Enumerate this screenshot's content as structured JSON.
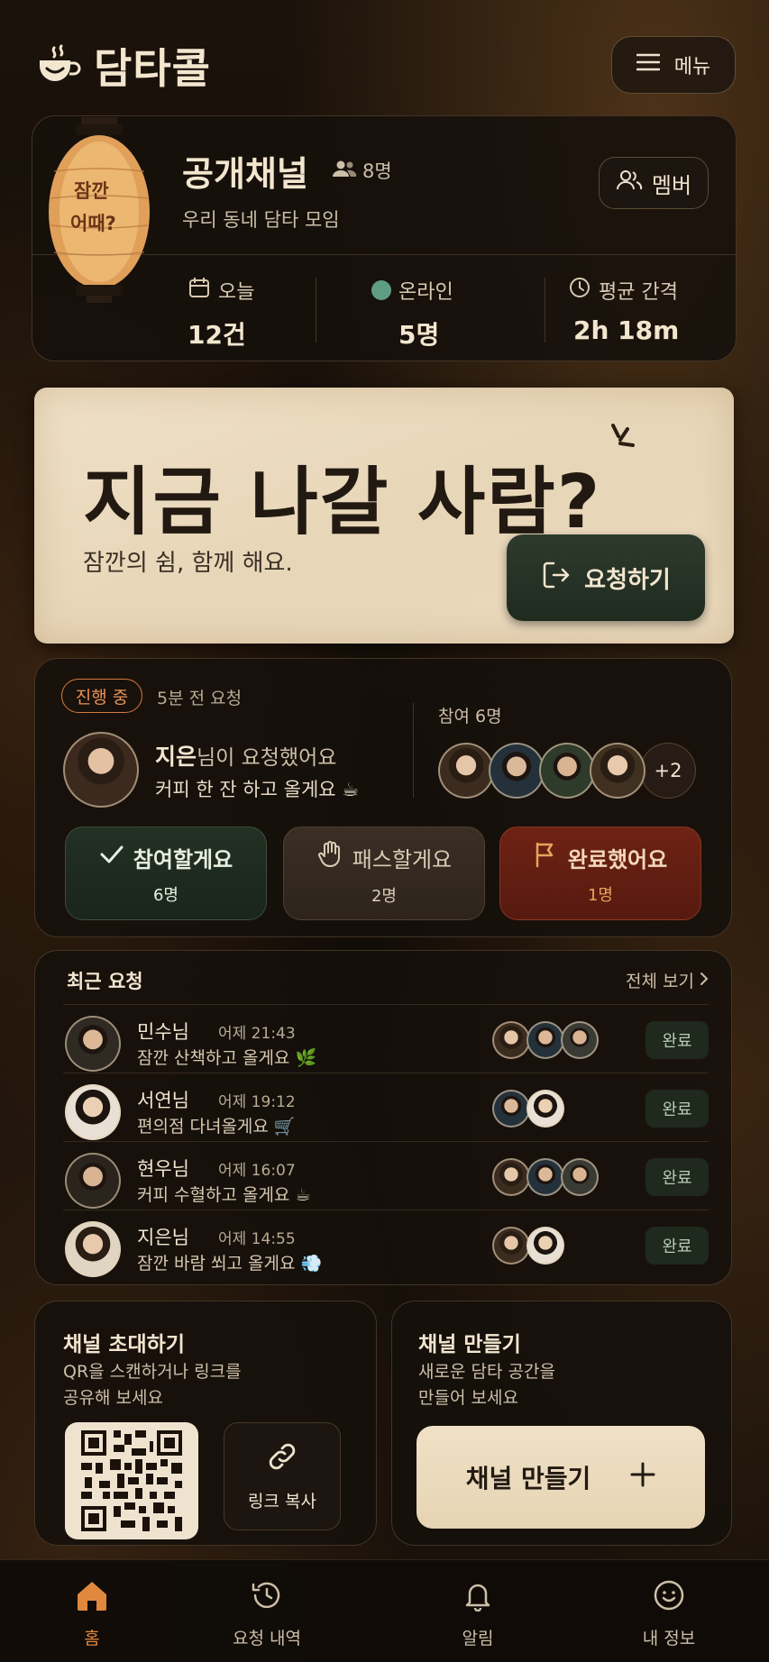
{
  "header": {
    "app_title": "담타콜",
    "menu_label": "메뉴"
  },
  "channel": {
    "lantern_text_1": "잠깐",
    "lantern_text_2": "어때?",
    "name": "공개채널",
    "member_count": "8명",
    "description": "우리 동네 담타 모임",
    "member_button": "멤버",
    "stats": {
      "today_label": "오늘",
      "today_value": "12건",
      "online_label": "온라인",
      "online_value": "5명",
      "interval_label": "평균 간격",
      "interval_value": "2h 18m"
    }
  },
  "hero": {
    "title": "지금 나갈 사람?",
    "subtitle": "잠깐의 쉼, 함께 해요.",
    "request_button": "요청하기"
  },
  "active": {
    "status_badge": "진행 중",
    "time_ago": "5분 전 요청",
    "requester_name": "지은",
    "requester_suffix": "님이 요청했어요",
    "message": "커피 한 잔 하고 올게요 ☕",
    "participants_label": "참여 6명",
    "more_count": "+2",
    "actions": {
      "join_label": "참여할게요",
      "join_count": "6명",
      "pass_label": "패스할게요",
      "pass_count": "2명",
      "done_label": "완료했어요",
      "done_count": "1명"
    }
  },
  "recent": {
    "title": "최근 요청",
    "see_all": "전체 보기",
    "rows": [
      {
        "name": "민수님",
        "time": "어제 21:43",
        "message": "잠깐 산책하고 올게요 🌿",
        "status": "완료"
      },
      {
        "name": "서연님",
        "time": "어제 19:12",
        "message": "편의점 다녀올게요 🛒",
        "status": "완료"
      },
      {
        "name": "현우님",
        "time": "어제 16:07",
        "message": "커피 수혈하고 올게요 ☕",
        "status": "완료"
      },
      {
        "name": "지은님",
        "time": "어제 14:55",
        "message": "잠깐 바람 쐬고 올게요 💨",
        "status": "완료"
      }
    ]
  },
  "invite": {
    "title": "채널 초대하기",
    "line1": "QR을 스캔하거나 링크를",
    "line2": "공유해 보세요",
    "copy_label": "링크 복사"
  },
  "create": {
    "title": "채널 만들기",
    "line1": "새로운 담타 공간을",
    "line2": "만들어 보세요",
    "button_label": "채널 만들기"
  },
  "nav": {
    "home": "홈",
    "history": "요청 내역",
    "alerts": "알림",
    "profile": "내 정보"
  },
  "colors": {
    "accent": "#e0883e",
    "join": "#233024",
    "done": "#6e2214",
    "paper": "#ecdcc0"
  }
}
